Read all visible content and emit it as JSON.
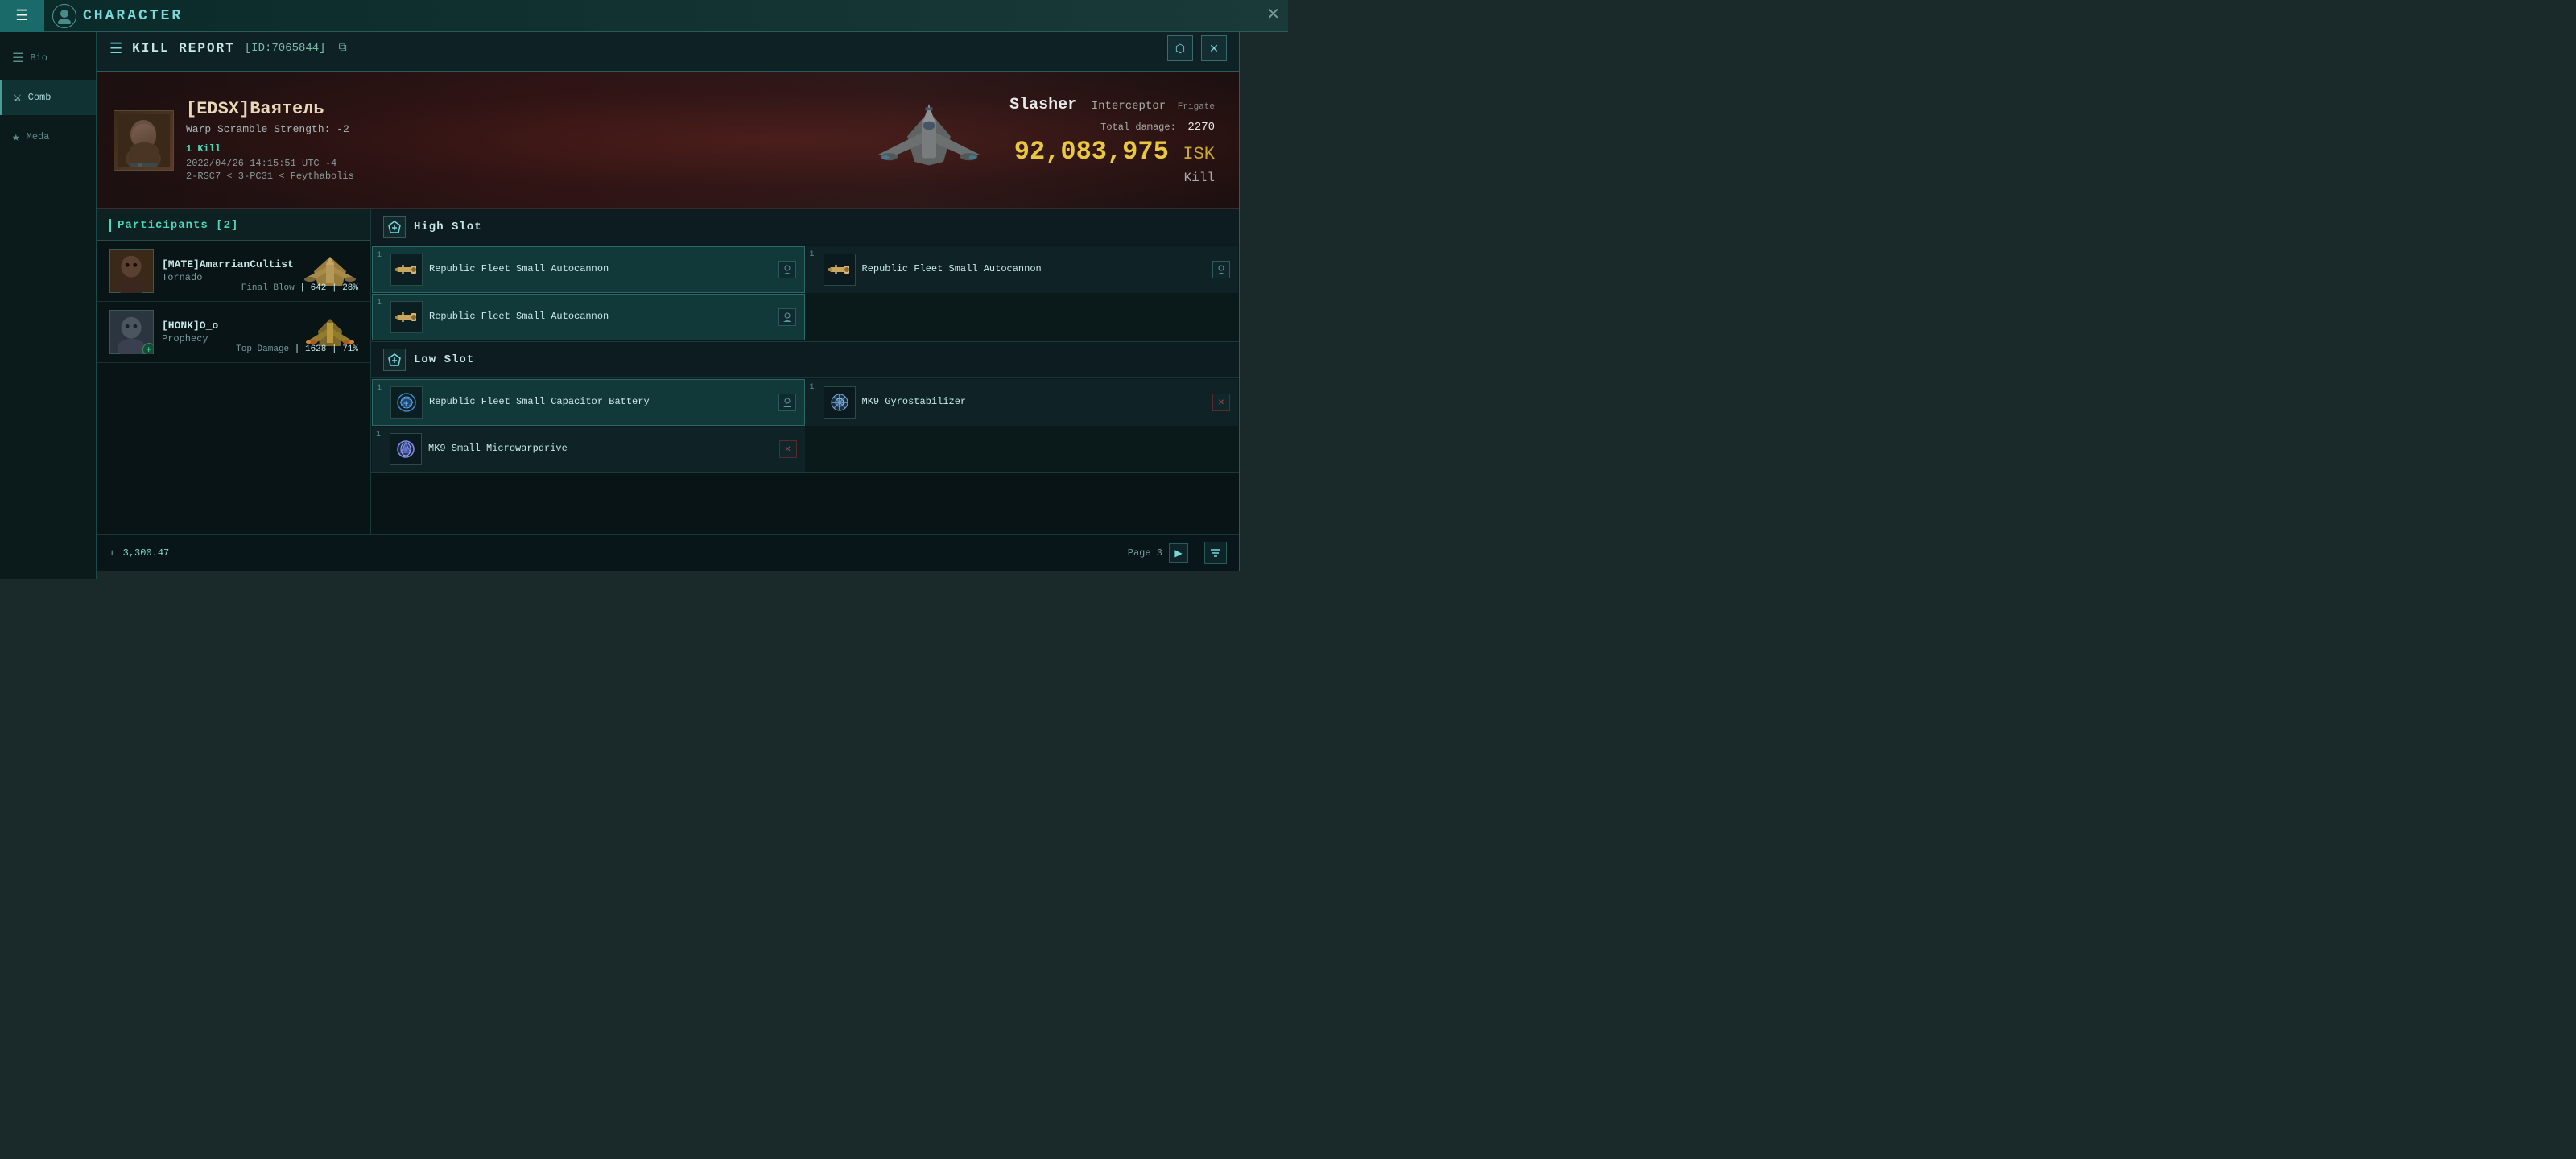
{
  "topbar": {
    "title": "CHARACTER",
    "close_label": "✕"
  },
  "sidebar": {
    "items": [
      {
        "id": "bio",
        "label": "Bio",
        "icon": "☰"
      },
      {
        "id": "combat",
        "label": "Comb",
        "icon": "✕"
      },
      {
        "id": "medals",
        "label": "Meda",
        "icon": "★"
      }
    ]
  },
  "panel": {
    "menu_icon": "☰",
    "title": "KILL REPORT",
    "id": "[ID:7065844]",
    "copy_icon": "⧉",
    "actions": {
      "export_icon": "⬡",
      "close_icon": "✕"
    }
  },
  "hero": {
    "pilot_name": "[EDSX]Ваятель",
    "pilot_meta": "Warp Scramble Strength: -2",
    "kill_tag": "1 Kill",
    "datetime": "2022/04/26 14:15:51 UTC -4",
    "location": "2-RSC7 < 3-PC31 < Feythabolis",
    "ship_name": "Slasher",
    "ship_type": "Interceptor",
    "ship_class": "Frigate",
    "total_damage_label": "Total damage:",
    "total_damage": "2270",
    "isk_value": "92,083,975",
    "isk_unit": "ISK",
    "result": "Kill"
  },
  "participants": {
    "section_title": "Participants [2]",
    "items": [
      {
        "name": "[MATE]AmarrianCultist",
        "ship": "Tornado",
        "stat_label": "Final Blow",
        "damage": "642",
        "percent": "28%"
      },
      {
        "name": "[HONK]O_o",
        "ship": "Prophecy",
        "stat_label": "Top Damage",
        "damage": "1628",
        "percent": "71%"
      }
    ]
  },
  "equipment": {
    "high_slot": {
      "title": "High Slot",
      "items": [
        {
          "num": "1",
          "name": "Republic Fleet Small Autocannon",
          "highlighted": true
        },
        {
          "num": "1",
          "name": "Republic Fleet Small Autocannon",
          "highlighted": false
        },
        {
          "num": "1",
          "name": "Republic Fleet Small Autocannon",
          "highlighted": true
        }
      ]
    },
    "low_slot": {
      "title": "Low Slot",
      "items": [
        {
          "num": "1",
          "name": "Republic Fleet Small Capacitor Battery",
          "highlighted": true,
          "has_plus": true
        },
        {
          "num": "1",
          "name": "MK9 Gyrostabilizer",
          "highlighted": false,
          "destroyed": true
        },
        {
          "num": "1",
          "name": "MK9 Small Microwarpdrive",
          "highlighted": false,
          "destroyed": true
        }
      ]
    }
  },
  "bottom": {
    "value": "3,300.47",
    "page_label": "Page 3"
  }
}
